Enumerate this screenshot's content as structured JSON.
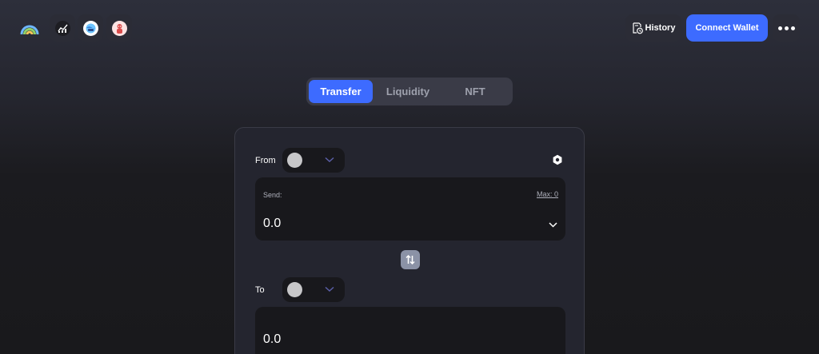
{
  "header": {
    "logo_icon": "rainbow-icon",
    "apps": [
      {
        "name": "chart-app-icon"
      },
      {
        "name": "globe-app-icon"
      },
      {
        "name": "avatar-app-icon"
      }
    ],
    "history_label": "History",
    "connect_label": "Connect Wallet",
    "accent_color": "#3d6bff"
  },
  "tabs": [
    {
      "label": "Transfer",
      "active": true
    },
    {
      "label": "Liquidity",
      "active": false
    },
    {
      "label": "NFT",
      "active": false
    }
  ],
  "form": {
    "from_label": "From",
    "to_label": "To",
    "send_label": "Send:",
    "max_label": "Max: 0",
    "send_amount": "0.0",
    "receive_amount": "0.0"
  }
}
